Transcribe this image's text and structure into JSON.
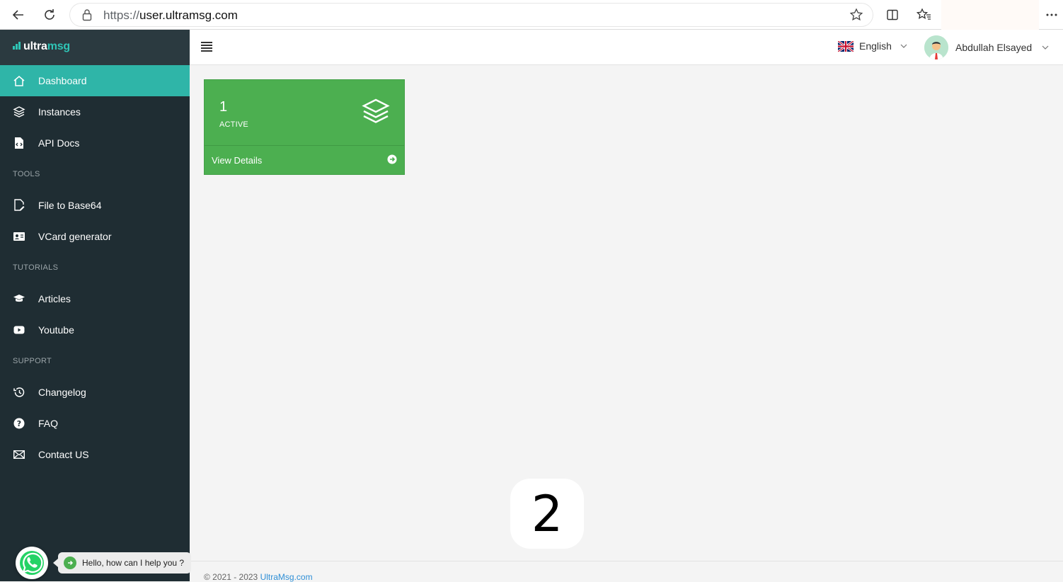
{
  "browser": {
    "url_scheme": "https://",
    "url_host": "user.ultramsg.com"
  },
  "brand": {
    "name_part1": "ultra",
    "name_part2": "msg"
  },
  "sidebar": {
    "items": [
      {
        "label": "Dashboard"
      },
      {
        "label": "Instances"
      },
      {
        "label": "API Docs"
      }
    ],
    "sections": {
      "tools": "TOOLS",
      "tutorials": "TUTORIALS",
      "support": "SUPPORT"
    },
    "tools_items": [
      {
        "label": "File to Base64"
      },
      {
        "label": "VCard generator"
      }
    ],
    "tutorials_items": [
      {
        "label": "Articles"
      },
      {
        "label": "Youtube"
      }
    ],
    "support_items": [
      {
        "label": "Changelog"
      },
      {
        "label": "FAQ"
      },
      {
        "label": "Contact US"
      }
    ]
  },
  "header": {
    "language": "English",
    "user_name": "Abdullah Elsayed"
  },
  "card": {
    "count": "1",
    "label": "ACTIVE",
    "footer_label": "View Details"
  },
  "overlay_number": "2",
  "footer": {
    "copyright": "© 2021 - 2023 ",
    "link_text": "UltraMsg.com"
  },
  "whatsapp": {
    "message": "Hello, how can I help you ?"
  },
  "colors": {
    "sidebar_bg": "#1f2d33",
    "active_item": "#2fb5a8",
    "card_green": "#4caf50",
    "brand_accent": "#2fc5b6"
  }
}
